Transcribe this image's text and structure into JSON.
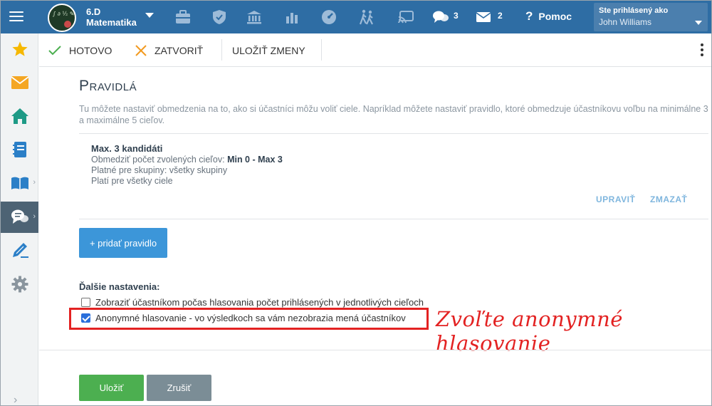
{
  "header": {
    "class_grade": "6.D",
    "class_subject": "Matematika",
    "messages_count": "3",
    "mail_count": "2",
    "help_label": "Pomoc",
    "user_label": "Ste prihlásený ako",
    "user_name": "John Williams",
    "nav_icons": [
      "briefcase-icon",
      "shield-icon",
      "bank-icon",
      "bar-chart-icon",
      "speedometer-icon",
      "hikers-icon",
      "cast-icon",
      "chat-bubbles-icon",
      "envelope-icon"
    ]
  },
  "sidebar": {
    "items": [
      {
        "icon": "star-icon"
      },
      {
        "icon": "mail-icon"
      },
      {
        "icon": "home-icon"
      },
      {
        "icon": "notebook-icon"
      },
      {
        "icon": "book-icon"
      },
      {
        "icon": "chat-icon",
        "active": true
      },
      {
        "icon": "pencil-icon"
      },
      {
        "icon": "gear-icon"
      }
    ]
  },
  "toolbar": {
    "done_label": "HOTOVO",
    "close_label": "ZATVORIŤ",
    "save_changes_label": "ULOŽIŤ ZMENY"
  },
  "main": {
    "title": "Pravidlá",
    "description": "Tu môžete nastaviť obmedzenia na to, ako si účastníci môžu voliť ciele. Napríklad môžete nastaviť pravidlo, ktoré obmedzuje účastníkovu voľbu na minimálne 3 a maximálne 5 cieľov.",
    "rule": {
      "title": "Max. 3 kandidáti",
      "limit_prefix": "Obmedziť počet zvolených cieľov: ",
      "limit_value": "Min 0 - Max 3",
      "groups": "Platné pre skupiny: všetky skupiny",
      "targets": "Platí pre všetky ciele",
      "edit_label": "UPRAVIŤ",
      "delete_label": "ZMAZAŤ"
    },
    "add_rule_label": "+ pridať pravidlo",
    "other_settings_title": "Ďalšie nastavenia:",
    "option_show_count": {
      "label": "Zobraziť účastníkom počas hlasovania počet prihlásených v jednotlivých cieľoch",
      "checked": false
    },
    "option_anonymous": {
      "label": "Anonymné hlasovanie - vo výsledkoch sa vám nezobrazia mená účastníkov",
      "checked": true
    },
    "annotation": "Zvoľte anonymné hlasovanie",
    "save_label": "Uložiť",
    "cancel_label": "Zrušiť"
  },
  "colors": {
    "topbar": "#2e6da4",
    "accent_blue": "#3c96d9",
    "save_green": "#4caf50",
    "cancel_gray": "#7b8d96",
    "annotation_red": "#e32222"
  }
}
